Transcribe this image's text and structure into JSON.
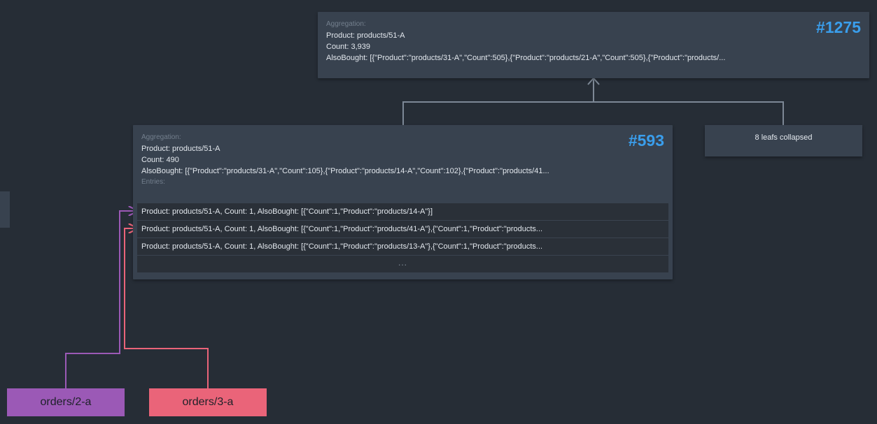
{
  "colors": {
    "background": "#262d36",
    "node": "#38424f",
    "accent": "#3a9eec",
    "purple": "#9b59b6",
    "pink": "#ea6479",
    "connector": "#7d8896"
  },
  "nodes": {
    "root": {
      "id": "#1275",
      "aggregation_label": "Aggregation:",
      "product": "Product: products/51-A",
      "count": "Count: 3,939",
      "also_bought": "AlsoBought: [{\"Product\":\"products/31-A\",\"Count\":505},{\"Product\":\"products/21-A\",\"Count\":505},{\"Product\":\"products/..."
    },
    "child": {
      "id": "#593",
      "aggregation_label": "Aggregation:",
      "product": "Product: products/51-A",
      "count": "Count: 490",
      "also_bought": "AlsoBought: [{\"Product\":\"products/31-A\",\"Count\":105},{\"Product\":\"products/14-A\",\"Count\":102},{\"Product\":\"products/41...",
      "entries_label": "Entries:",
      "entries": [
        "Product: products/51-A, Count: 1, AlsoBought: [{\"Count\":1,\"Product\":\"products/14-A\"}]",
        "Product: products/51-A, Count: 1, AlsoBought: [{\"Count\":1,\"Product\":\"products/41-A\"},{\"Count\":1,\"Product\":\"products...",
        "Product: products/51-A, Count: 1, AlsoBought: [{\"Count\":1,\"Product\":\"products/13-A\"},{\"Count\":1,\"Product\":\"products..."
      ],
      "more": "..."
    },
    "collapsed": {
      "label": "8 leafs collapsed"
    }
  },
  "sources": {
    "orders_2a": "orders/2-a",
    "orders_3a": "orders/3-a"
  }
}
